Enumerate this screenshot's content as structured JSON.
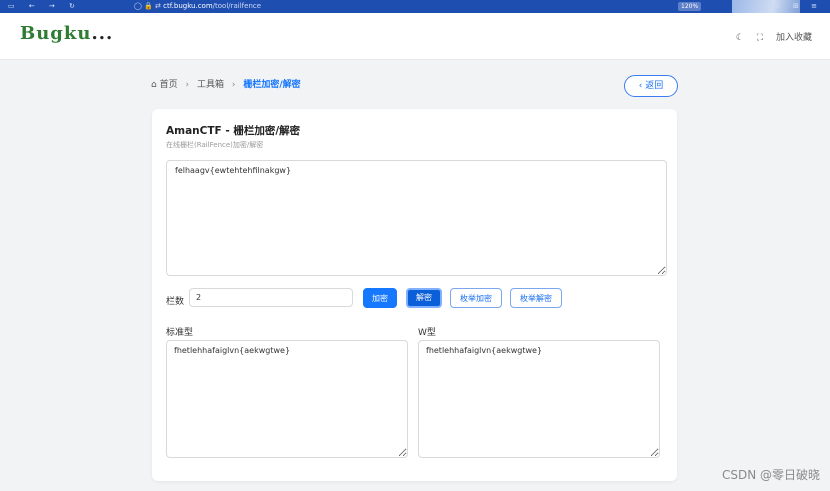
{
  "browser": {
    "nav_icons": "▭ ← → ↻",
    "security_icons": "◯ 🔒 ⇄",
    "url_host": "ctf.bugku.com",
    "url_path": "/tool/railfence",
    "zoom": "120%",
    "right_icons": "☆ ⊞ ≡"
  },
  "header": {
    "logo_text": "Bugku",
    "logo_suffix": "...",
    "favorite_label": "加入收藏"
  },
  "breadcrumb": {
    "home": "首页",
    "toolbox": "工具箱",
    "current": "栅栏加密/解密"
  },
  "back_label": "返回",
  "card": {
    "title": "AmanCTF - 栅栏加密/解密",
    "subtitle": "在线栅栏(RailFence)加密/解密",
    "input_text": "felhaagv{ewtehtehfilnakgw}",
    "rows_label": "栏数",
    "rows_value": "2",
    "buttons": {
      "encrypt": "加密",
      "decrypt": "解密",
      "enum_encrypt": "枚举加密",
      "enum_decrypt": "枚举解密"
    },
    "standard_label": "标准型",
    "standard_output": "fhetlehhafaiglvn{aekwgtwe}",
    "w_label": "W型",
    "w_output": "fhetlehhafaiglvn{aekwgtwe}"
  },
  "watermark": "CSDN @零日破晓",
  "colors": {
    "primary": "#1677ff",
    "browser_bar": "#1e4fb0",
    "logo_green": "#2e7d32"
  }
}
